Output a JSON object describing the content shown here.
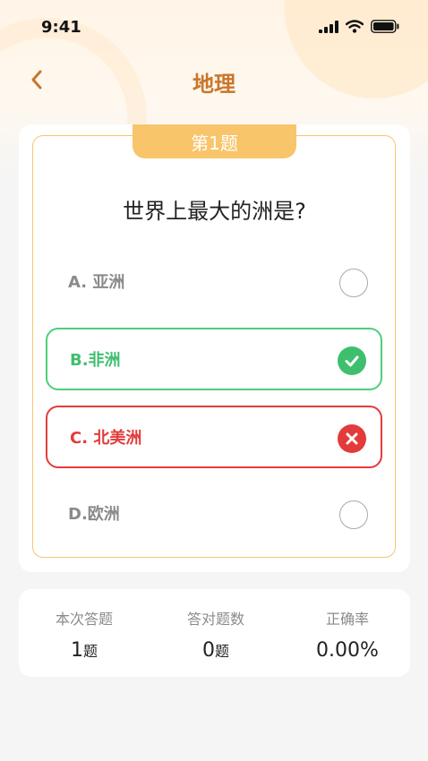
{
  "status_bar": {
    "time": "9:41"
  },
  "nav": {
    "title": "地理"
  },
  "quiz": {
    "question_number": "第1题",
    "question": "世界上最大的洲是?",
    "options": [
      {
        "label": "A. 亚洲",
        "state": "unselected"
      },
      {
        "label": "B.非洲",
        "state": "correct"
      },
      {
        "label": "C. 北美洲",
        "state": "wrong"
      },
      {
        "label": "D.欧洲",
        "state": "unselected"
      }
    ]
  },
  "stats": {
    "answered_label": "本次答题",
    "answered_value": "1",
    "answered_unit": "题",
    "correct_label": "答对题数",
    "correct_value": "0",
    "correct_unit": "题",
    "rate_label": "正确率",
    "rate_value": "0.00%"
  },
  "colors": {
    "accent": "#c9762a",
    "tab": "#f8c56b",
    "correct": "#3fbf6e",
    "wrong": "#e33b3b"
  },
  "icons": {
    "back": "chevron-left-icon",
    "correct": "check-circle-icon",
    "wrong": "x-circle-icon"
  }
}
